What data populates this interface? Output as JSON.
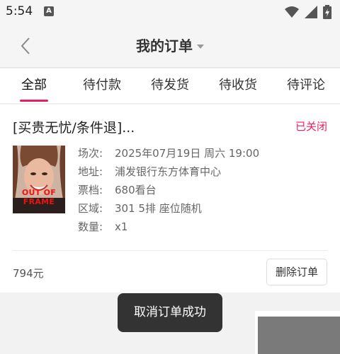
{
  "status_bar": {
    "time": "5:54",
    "notification_badge": "A"
  },
  "header": {
    "title": "我的订单"
  },
  "tabs": [
    {
      "label": "全部",
      "active": true
    },
    {
      "label": "待付款",
      "active": false
    },
    {
      "label": "待发货",
      "active": false
    },
    {
      "label": "待收货",
      "active": false
    },
    {
      "label": "待评论",
      "active": false
    }
  ],
  "order": {
    "title": "[买贵无忧/条件退]...",
    "status": "已关闭",
    "poster_text": "OUT OF FRAME",
    "details": [
      {
        "label": "场次:",
        "value": "2025年07月19日 周六 19:00"
      },
      {
        "label": "地址:",
        "value": "浦发银行东方体育中心"
      },
      {
        "label": "票档:",
        "value": "680看台"
      },
      {
        "label": "区域:",
        "value": "301 5排 座位随机"
      },
      {
        "label": "数量:",
        "value": "x1"
      }
    ],
    "price": "794元",
    "delete_label": "删除订单"
  },
  "toast": {
    "message": "取消订单成功"
  },
  "colors": {
    "accent": "#e91e63",
    "toast_bg": "#333333"
  }
}
